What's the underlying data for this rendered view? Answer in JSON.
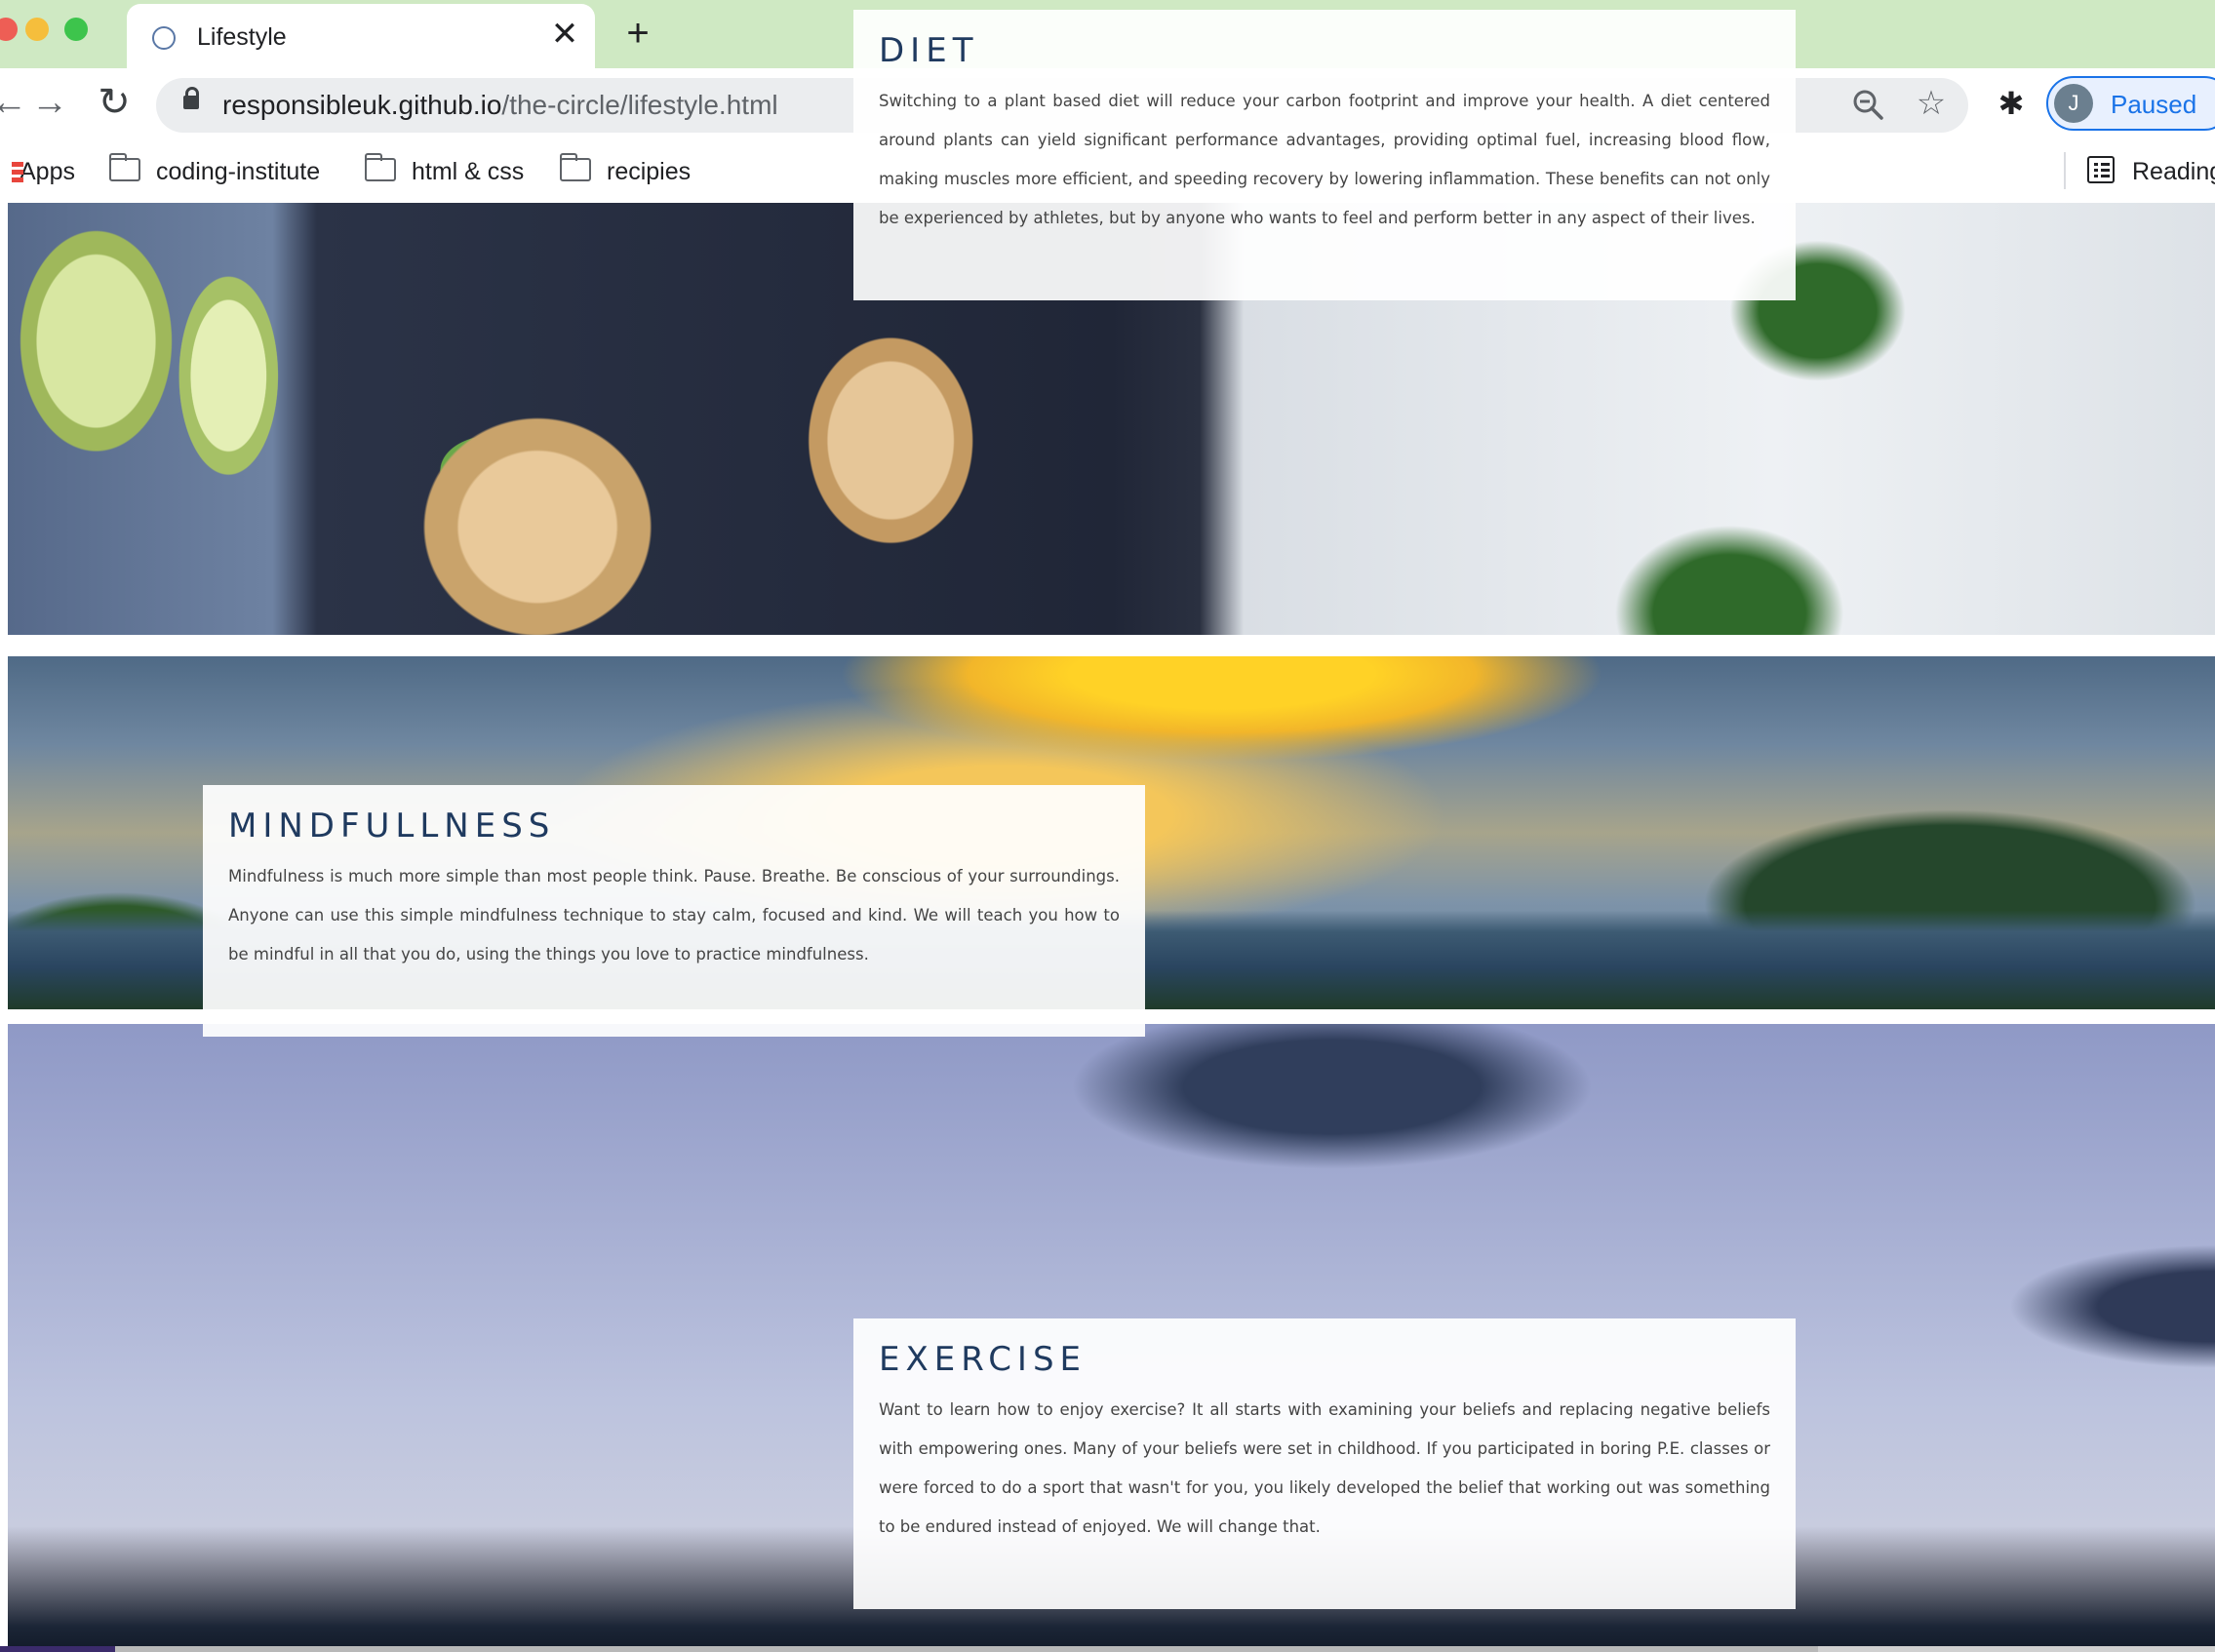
{
  "browser": {
    "tab": {
      "title": "Lifestyle",
      "close_glyph": "✕",
      "favicon": "globe-icon"
    },
    "new_tab_glyph": "+",
    "nav": {
      "back_glyph": "←",
      "forward_glyph": "→",
      "reload_glyph": "↻"
    },
    "address": {
      "domain": "responsibleuk.github.io",
      "path": "/the-circle/lifestyle.html"
    },
    "star_glyph": "☆",
    "extensions_glyph": "✱",
    "profile": {
      "initial": "J",
      "label": "Paused"
    },
    "bookmarks": {
      "apps": "Apps",
      "items": [
        "coding-institute",
        "html & css",
        "recipies"
      ],
      "reading_list": "Reading"
    }
  },
  "sections": {
    "diet": {
      "title": "DIET",
      "text": "Switching to a plant based diet will reduce your carbon footprint and improve your health. A diet centered around plants can yield significant performance advantages, providing optimal fuel, increasing blood flow, making muscles more efficient, and speeding recovery by lowering inflammation. These benefits can not only be experienced by athletes, but by anyone who wants to feel and perform better in any aspect of their lives."
    },
    "mindfullness": {
      "title": "MINDFULLNESS",
      "text": "Mindfulness is much more simple than most people think. Pause. Breathe. Be conscious of your surroundings. Anyone can use this simple mindfulness technique to stay calm, focused and kind. We will teach you how to be mindful in all that you do, using the things you love to practice mindfulness."
    },
    "exercise": {
      "title": "EXERCISE",
      "text": "Want to learn how to enjoy exercise? It all starts with examining your beliefs and replacing negative beliefs with empowering ones. Many of your beliefs were set in childhood. If you participated in boring P.E. classes or were forced to do a sport that wasn't for you, you likely developed the belief that working out was something to be endured instead of enjoyed. We will change that."
    }
  }
}
